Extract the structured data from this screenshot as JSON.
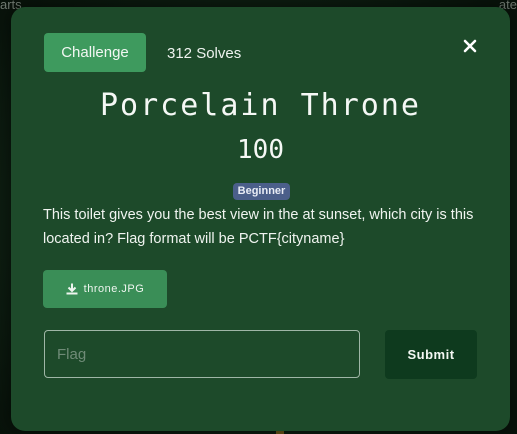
{
  "background": {
    "left_text": "arts",
    "right_text": "ate"
  },
  "modal": {
    "tab_label": "Challenge",
    "solves_text": "312 Solves",
    "close_icon": "close-icon",
    "title": "Porcelain Throne",
    "value": "100",
    "badge": "Beginner",
    "description": "This toilet gives you the best view in the at sunset, which city is this located in? Flag format will be PCTF{cityname}",
    "file": {
      "icon": "download-icon",
      "label": "throne.JPG"
    },
    "flag_input": {
      "placeholder": "Flag",
      "value": ""
    },
    "submit_label": "Submit"
  },
  "colors": {
    "modal_bg": "#1d4a2a",
    "tab_bg": "#3e9a5e",
    "badge_bg": "#4b5f8a",
    "submit_bg": "#0e3a1e"
  }
}
